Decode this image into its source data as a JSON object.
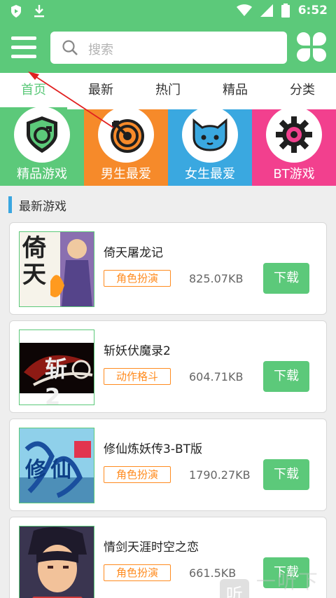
{
  "status_bar": {
    "time": "6:52"
  },
  "search": {
    "placeholder": "搜索"
  },
  "tabs": [
    {
      "label": "首页",
      "active": true
    },
    {
      "label": "最新",
      "active": false
    },
    {
      "label": "热门",
      "active": false
    },
    {
      "label": "精品",
      "active": false
    },
    {
      "label": "分类",
      "active": false
    }
  ],
  "categories": [
    {
      "label": "精品游戏",
      "color": "#5cc97a",
      "icon": "shield-icon"
    },
    {
      "label": "男生最爱",
      "color": "#f68a2a",
      "icon": "target-icon"
    },
    {
      "label": "女生最爱",
      "color": "#3aa8e0",
      "icon": "cat-icon"
    },
    {
      "label": "BT游戏",
      "color": "#f2408e",
      "icon": "gear-icon"
    }
  ],
  "section_title": "最新游戏",
  "games": [
    {
      "name": "倚天屠龙记",
      "tag": "角色扮演",
      "size": "825.07KB",
      "button": "下载",
      "thumb_text": "倚天"
    },
    {
      "name": "斩妖伏魔录2",
      "tag": "动作格斗",
      "size": "604.71KB",
      "button": "下载",
      "thumb_text": "斩2"
    },
    {
      "name": "修仙炼妖传3-BT版",
      "tag": "角色扮演",
      "size": "1790.27KB",
      "button": "下载",
      "thumb_text": "修仙"
    },
    {
      "name": "情剑天涯时空之恋",
      "tag": "角色扮演",
      "size": "661.5KB",
      "button": "下载",
      "thumb_text": ""
    }
  ],
  "watermark": {
    "logo": "听",
    "text": "一听下载"
  },
  "colors": {
    "brand": "#5cc97a",
    "tag": "#ff8b1f",
    "section_bar": "#3aa6e0"
  }
}
